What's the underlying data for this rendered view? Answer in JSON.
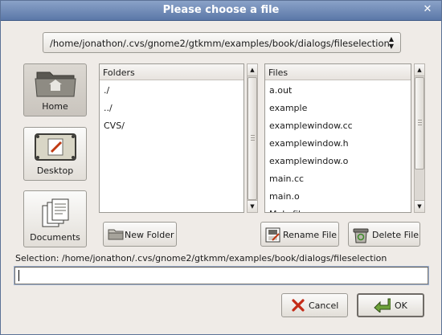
{
  "window": {
    "title": "Please choose a file",
    "close_glyph": "✕"
  },
  "path_combo": {
    "value": "/home/jonathon/.cvs/gnome2/gtkmm/examples/book/dialogs/fileselection"
  },
  "places": [
    {
      "label": "Home",
      "icon": "home-folder-icon"
    },
    {
      "label": "Desktop",
      "icon": "desktop-icon"
    },
    {
      "label": "Documents",
      "icon": "documents-icon"
    }
  ],
  "folders": {
    "header": "Folders",
    "items": [
      "./",
      "../",
      "CVS/"
    ]
  },
  "files": {
    "header": "Files",
    "items": [
      "a.out",
      "example",
      "examplewindow.cc",
      "examplewindow.h",
      "examplewindow.o",
      "main.cc",
      "main.o",
      "Makefile"
    ]
  },
  "buttons": {
    "new_folder": "New Folder",
    "rename_file": "Rename File",
    "delete_file": "Delete File",
    "cancel": "Cancel",
    "ok": "OK"
  },
  "selection": {
    "label": "Selection: /home/jonathon/.cvs/gnome2/gtkmm/examples/book/dialogs/fileselection",
    "value": ""
  },
  "colors": {
    "titlebar": "#6b87b4",
    "dialog_bg": "#efebe7",
    "focus_ring": "#9db1d3"
  }
}
